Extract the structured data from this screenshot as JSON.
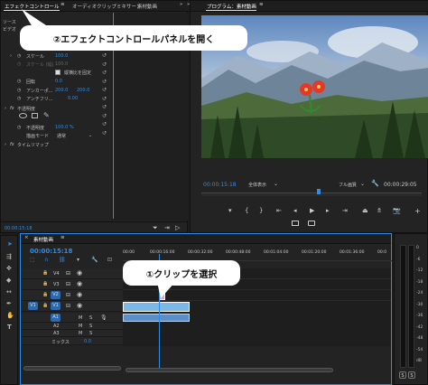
{
  "callouts": {
    "step2": "②エフェクトコントロールパネルを開く",
    "step1": "①クリップを選択"
  },
  "tabs": {
    "effect_controls": "エフェクトコントロール",
    "audio_mixer": "オーディオクリップミキサー：",
    "source_name": "素材動画",
    "program_title": "プログラム：素材動画",
    "menu_glyph": "≡",
    "expand_glyph": "»"
  },
  "effects": {
    "source_row": "ソース",
    "video_row": "ビデオ",
    "scale_label": "スケール",
    "scale_value": "100.0",
    "scale_width_label": "スケール (幅)",
    "scale_width_value": "100.0",
    "uniform_scale": "縦横比を固定",
    "rotation_label": "回転",
    "rotation_value": "0.0",
    "anchor_label": "アンカーポ...",
    "anchor_x": "200.0",
    "anchor_y": "200.0",
    "antiflicker_label": "アンチフリ...",
    "antiflicker_value": "0.00",
    "opacity_label": "不透明度",
    "opacity_sub_label": "不透明度",
    "opacity_value": "100.0 %",
    "blend_label": "描画モード",
    "blend_value": "通常",
    "time_remap": "タイムリマップ",
    "timecode": "00:00:15:18"
  },
  "program": {
    "timecode": "00:00:15:18",
    "fit": "全体表示",
    "quality": "フル画質",
    "duration": "00:00:29:05"
  },
  "timeline": {
    "tab": "素材動画",
    "timecode": "00:00:15:18",
    "ruler": [
      "00:00",
      "00:00:16:00",
      "00:00:32:00",
      "00:00:48:00",
      "00:01:04:00",
      "00:01:20:00",
      "00:01:36:00",
      "00:0"
    ],
    "video_tracks": [
      {
        "name": "V4",
        "y": 0
      },
      {
        "name": "V3",
        "y": 1
      },
      {
        "name": "V2",
        "y": 2
      },
      {
        "name": "V1",
        "y": 3
      }
    ],
    "source_patch": "V1",
    "audio_tracks": [
      {
        "name": "A1"
      },
      {
        "name": "A2"
      },
      {
        "name": "A3"
      }
    ],
    "mix_label": "ミックス",
    "mix_value": "0.0",
    "btn_m": "M",
    "btn_s": "S"
  },
  "meter": {
    "labels": [
      "0",
      "-6",
      "-12",
      "-18",
      "-24",
      "-30",
      "-36",
      "-42",
      "-48",
      "-54",
      "dB"
    ],
    "solo": "S"
  },
  "colors": {
    "accent": "#2d8ceb",
    "clip": "#7ab8e8",
    "track_active": "#2a6ab0"
  }
}
